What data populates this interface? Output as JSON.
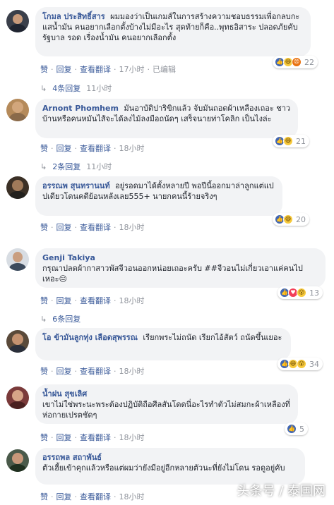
{
  "actions": {
    "like": "赞",
    "reply": "回复",
    "translate": "查看翻译"
  },
  "comments": [
    {
      "author": "โกมล ประสิทธิ์สาร",
      "text": "ผมมองว่าเป็นเกมส์ในการสร้างความชอบธรรมเพื่อกลบกะแสน้ำมัน คนอยากเลือกตั้งบ้างไม่มีอะไร สุดท้ายก็คือ..พุทธอิสาระ ปลอดภัยคับ รัฐบาล รอด เรื่องน้ำมัน คนอยากเลือกตั้ง",
      "time": "17小时",
      "edited": "已编辑",
      "reaction_count": "22",
      "replies": {
        "label": "4条回复",
        "time": "11小时"
      }
    },
    {
      "author": "Arnont Phomhem",
      "text": "มันอาบัติปาริขิกแล้ว จับมันถอดผ้าเหลืองเถอะ ชาวบ้านหรือคนหมันไส้จะได้ลงไม้ลงมือถนัดๆ เสร็จนายท่าโคลิก เป็นไงล่ะ",
      "time": "18小时",
      "reaction_count": "21",
      "replies": {
        "label": "2条回复",
        "time": "11小时"
      }
    },
    {
      "author": "อรรณพ สุนทรานนท์",
      "text": "อยู่รอดมาได้ตั้งหลายปี พอปีนี้ออกมาล่าลูกแต่แปปเดียวโดนคดีย้อนหลังเลย555+ นายกคนนี้ร้ายจริงๆ",
      "time": "18小时",
      "reaction_count": "20"
    },
    {
      "author": "Genji Takiya",
      "text": "กรุณาปลดผ้ากาสาวพัสจีวอนออกหน่อยเถอะครับ ##จีวอนไม่เกี่ยวเอาแค่คนไปเหอะ😑",
      "time": "18小时",
      "reaction_count": "13",
      "replies": {
        "label": "6条回复"
      }
    },
    {
      "author": "โอ ข้ามันลูกทุ่ง เลือดสุพรรณ",
      "text": "เรียกพระไม่ถนัด เรียกไอ้สัตว์ ถนัดขึ้นเยอะ",
      "time": "18小时",
      "reaction_count": "34"
    },
    {
      "author": "น้ำฝน สุขเลิศ",
      "text": "เขาไม่ใช่พระนะพระต้องปฏิบัติถือศีลสันโดดนี่อะไรทำตัวไม่สมกะผ้าเหลืองที่ห่อกายเปรตชัดๆ",
      "time": "18小时",
      "reaction_count": "5"
    },
    {
      "author": "อรรถพล สถาพันธ์",
      "text": "ตัวเฮี้ยเข้าคุกแล้วหรือแต่ผมว่ายังมีอยู่อีกหลายตัวนะที่ยังไม่โดน รอดูอยู่คับ",
      "time": "18小时"
    }
  ],
  "watermark": "头条号 / 泰国网"
}
